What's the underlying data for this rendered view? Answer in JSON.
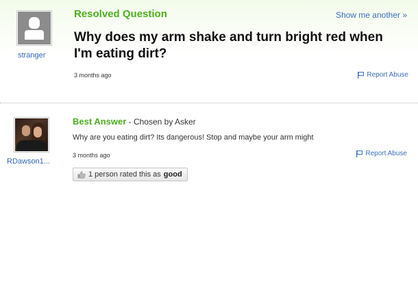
{
  "question": {
    "section_title": "Resolved Question",
    "show_another": "Show me another »",
    "title": "Why does my arm shake and turn bright red when I'm eating dirt?",
    "asker": "stranger",
    "time": "3 months ago",
    "report_abuse": "Report Abuse"
  },
  "answer": {
    "label": "Best Answer",
    "chosen_by": " - Chosen by Asker",
    "text": "Why are you eating dirt? Its dangerous! Stop and maybe your arm might",
    "answerer": "RDawson1...",
    "time": "3 months ago",
    "report_abuse": "Report Abuse",
    "rating_prefix": "1 person rated this as",
    "rating_value": "good"
  },
  "colors": {
    "accent_green": "#4caf1e",
    "link_blue": "#3b6fc2"
  },
  "icons": [
    "default-avatar-icon",
    "flag-icon",
    "thumbs-up-icon"
  ]
}
